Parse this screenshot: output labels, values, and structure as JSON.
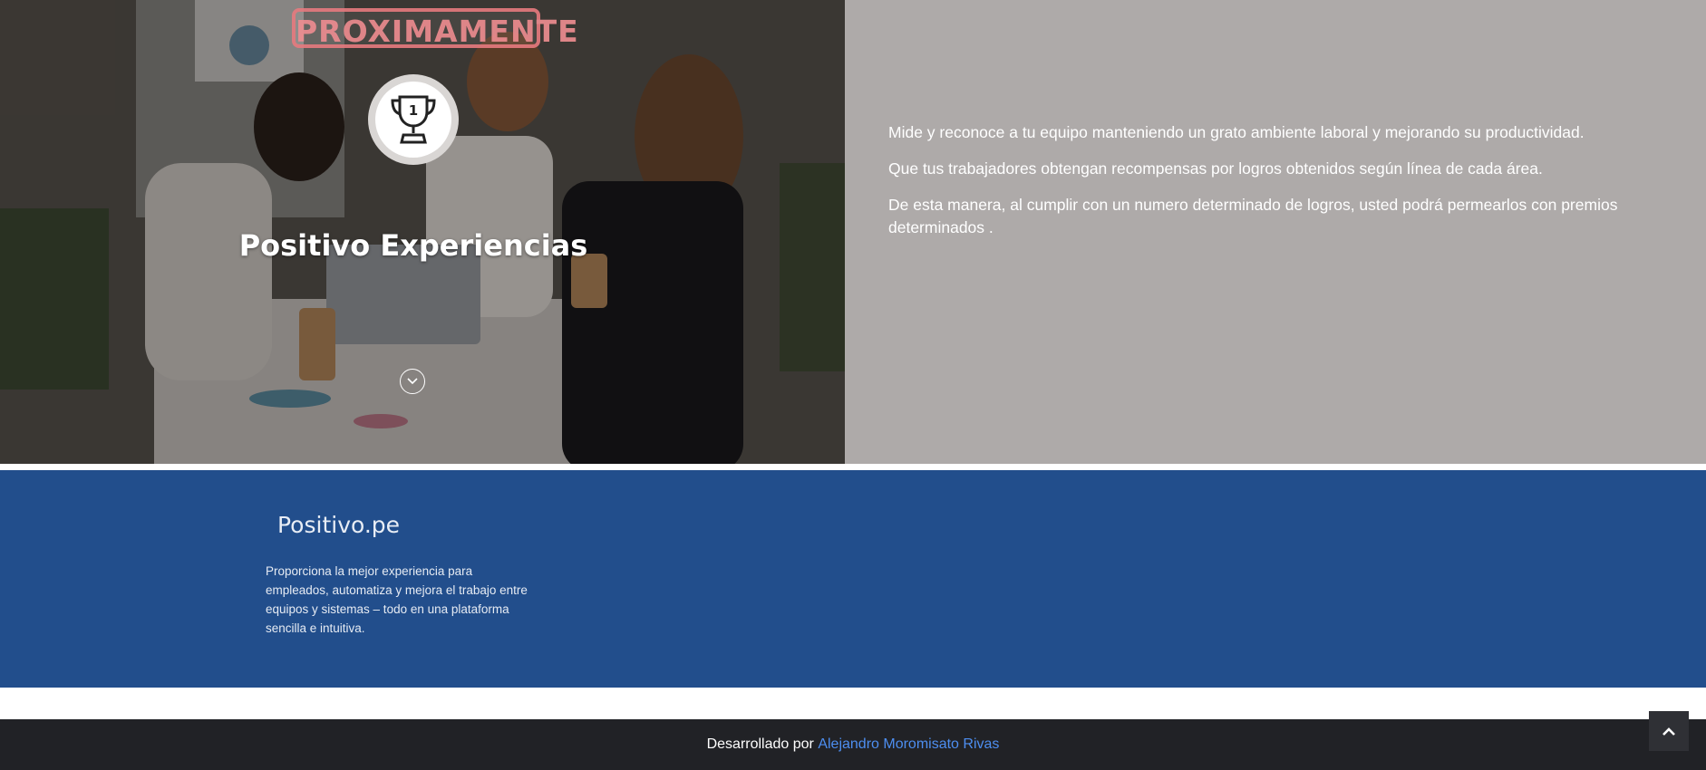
{
  "hero": {
    "stamp": "PROXIMAMENTE",
    "title": "Positivo Experiencias",
    "paragraphs": [
      "Mide y reconoce a tu equipo manteniendo un grato ambiente laboral y mejorando su productividad.",
      "Que tus trabajadores obtengan recompensas por logros obtenidos según línea de cada área.",
      "De esta manera, al cumplir con un numero determinado de logros, usted podrá permearlos con premios determinados ."
    ],
    "icons": {
      "trophy": "trophy-icon",
      "scroll": "chevron-down-icon"
    }
  },
  "about": {
    "brand": "Positivo.pe",
    "description": "Proporciona la mejor experiencia para empleados, automatiza y mejora el trabajo entre equipos y sistemas – todo en una plataforma sencilla e intuitiva."
  },
  "footer": {
    "prefix": "Desarrollado por",
    "author": "Alejandro Moromisato Rivas"
  },
  "colors": {
    "blue_section": "#224e8c",
    "right_panel": "#aeaaa9",
    "footer_bg": "#212226",
    "link": "#4d8ef0",
    "stamp": "#e77b7f"
  }
}
